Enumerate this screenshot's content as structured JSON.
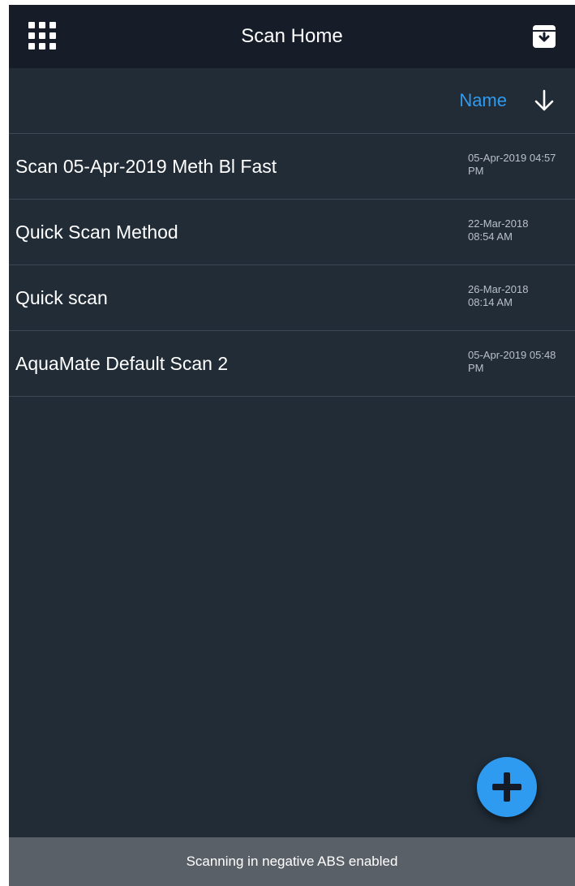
{
  "header": {
    "title": "Scan Home",
    "apps_icon": "grid-apps-icon",
    "archive_icon": "archive-download-icon"
  },
  "sort": {
    "label": "Name",
    "direction_icon": "arrow-down-icon"
  },
  "scans": [
    {
      "name": "Scan 05-Apr-2019 Meth Bl Fast",
      "date": "05-Apr-2019 04:57\nPM"
    },
    {
      "name": "Quick Scan Method",
      "date": "22-Mar-2018\n08:54 AM"
    },
    {
      "name": "Quick scan",
      "date": "26-Mar-2018\n08:14 AM"
    },
    {
      "name": "AquaMate Default Scan 2",
      "date": "05-Apr-2019 05:48\nPM"
    }
  ],
  "fab": {
    "icon": "plus-icon"
  },
  "status": {
    "text": "Scanning in negative ABS enabled"
  },
  "colors": {
    "background": "#212c37",
    "topbar": "#161d29",
    "accent": "#2f9bf0",
    "statusbar": "#5a6068"
  }
}
